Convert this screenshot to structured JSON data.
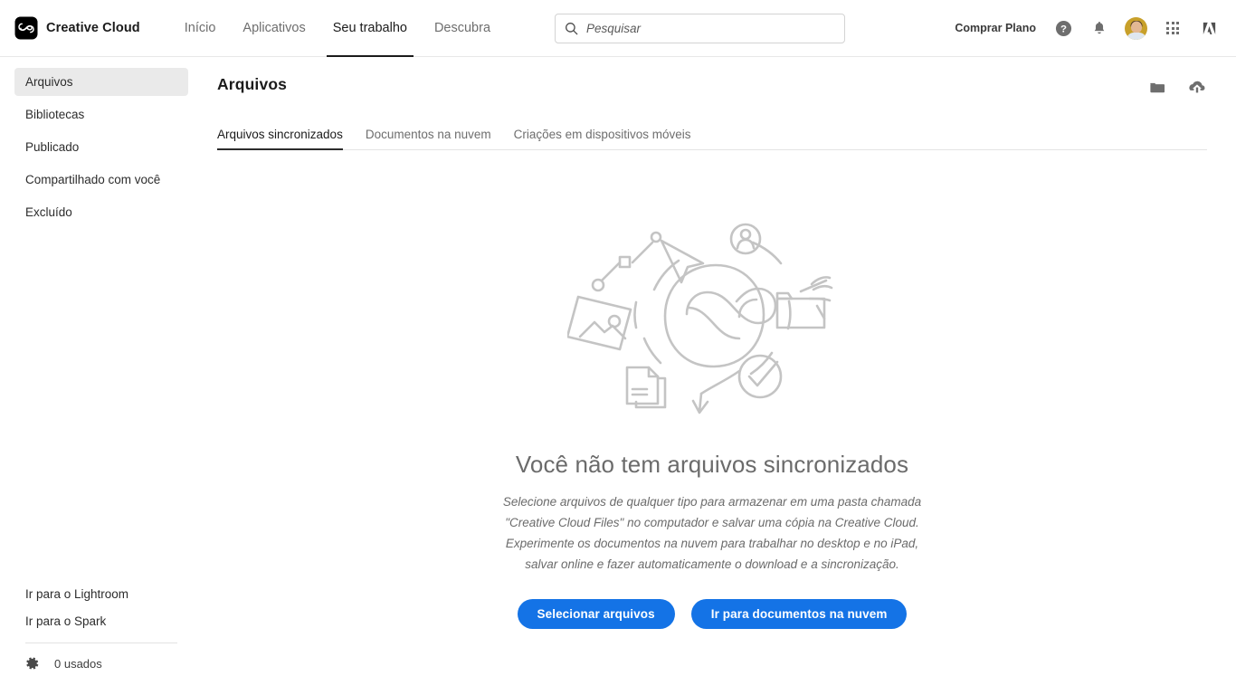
{
  "topbar": {
    "brand": "Creative Cloud",
    "logo_icon": "creative-cloud-logo-icon",
    "nav": [
      {
        "label": "Início",
        "active": false
      },
      {
        "label": "Aplicativos",
        "active": false
      },
      {
        "label": "Seu trabalho",
        "active": true
      },
      {
        "label": "Descubra",
        "active": false
      }
    ],
    "search": {
      "placeholder": "Pesquisar",
      "value": "",
      "icon": "search-icon"
    },
    "buy_plan": "Comprar Plano",
    "help_icon": "help-circle-icon",
    "notifications_icon": "bell-icon",
    "avatar_icon": "user-avatar",
    "apps_grid_icon": "app-grid-icon",
    "adobe_logo_icon": "adobe-logo-icon"
  },
  "sidebar": {
    "items": [
      {
        "label": "Arquivos",
        "active": true
      },
      {
        "label": "Bibliotecas",
        "active": false
      },
      {
        "label": "Publicado",
        "active": false
      },
      {
        "label": "Compartilhado com você",
        "active": false
      },
      {
        "label": "Excluído",
        "active": false
      }
    ],
    "links": [
      {
        "label": "Ir para o Lightroom"
      },
      {
        "label": "Ir para o Spark"
      }
    ],
    "storage": {
      "icon": "gear-icon",
      "label": "0 usados"
    }
  },
  "main": {
    "title": "Arquivos",
    "actions": [
      {
        "name": "new-folder-icon",
        "title": "Nova pasta"
      },
      {
        "name": "cloud-upload-icon",
        "title": "Carregar"
      }
    ],
    "tabs": [
      {
        "label": "Arquivos sincronizados",
        "active": true
      },
      {
        "label": "Documentos na nuvem",
        "active": false
      },
      {
        "label": "Criações em dispositivos móveis",
        "active": false
      }
    ],
    "empty_state": {
      "illustration": "creative-cloud-sync-illustration",
      "title": "Você não tem arquivos sincronizados",
      "description": "Selecione arquivos de qualquer tipo para armazenar em uma pasta chamada \"Creative Cloud Files\" no computador e salvar uma cópia na Creative Cloud. Experimente os documentos na nuvem para trabalhar no desktop e no iPad, salvar online e fazer automaticamente o download e a sincronização.",
      "primary_button": "Selecionar arquivos",
      "secondary_button": "Ir para documentos na nuvem"
    }
  },
  "colors": {
    "accent_blue": "#1473E6",
    "text_dark": "#2C2C2C",
    "text_muted": "#6E6E6E",
    "sidebar_active_bg": "#EAEAEA",
    "illustration_gray": "#C4C4C4"
  }
}
